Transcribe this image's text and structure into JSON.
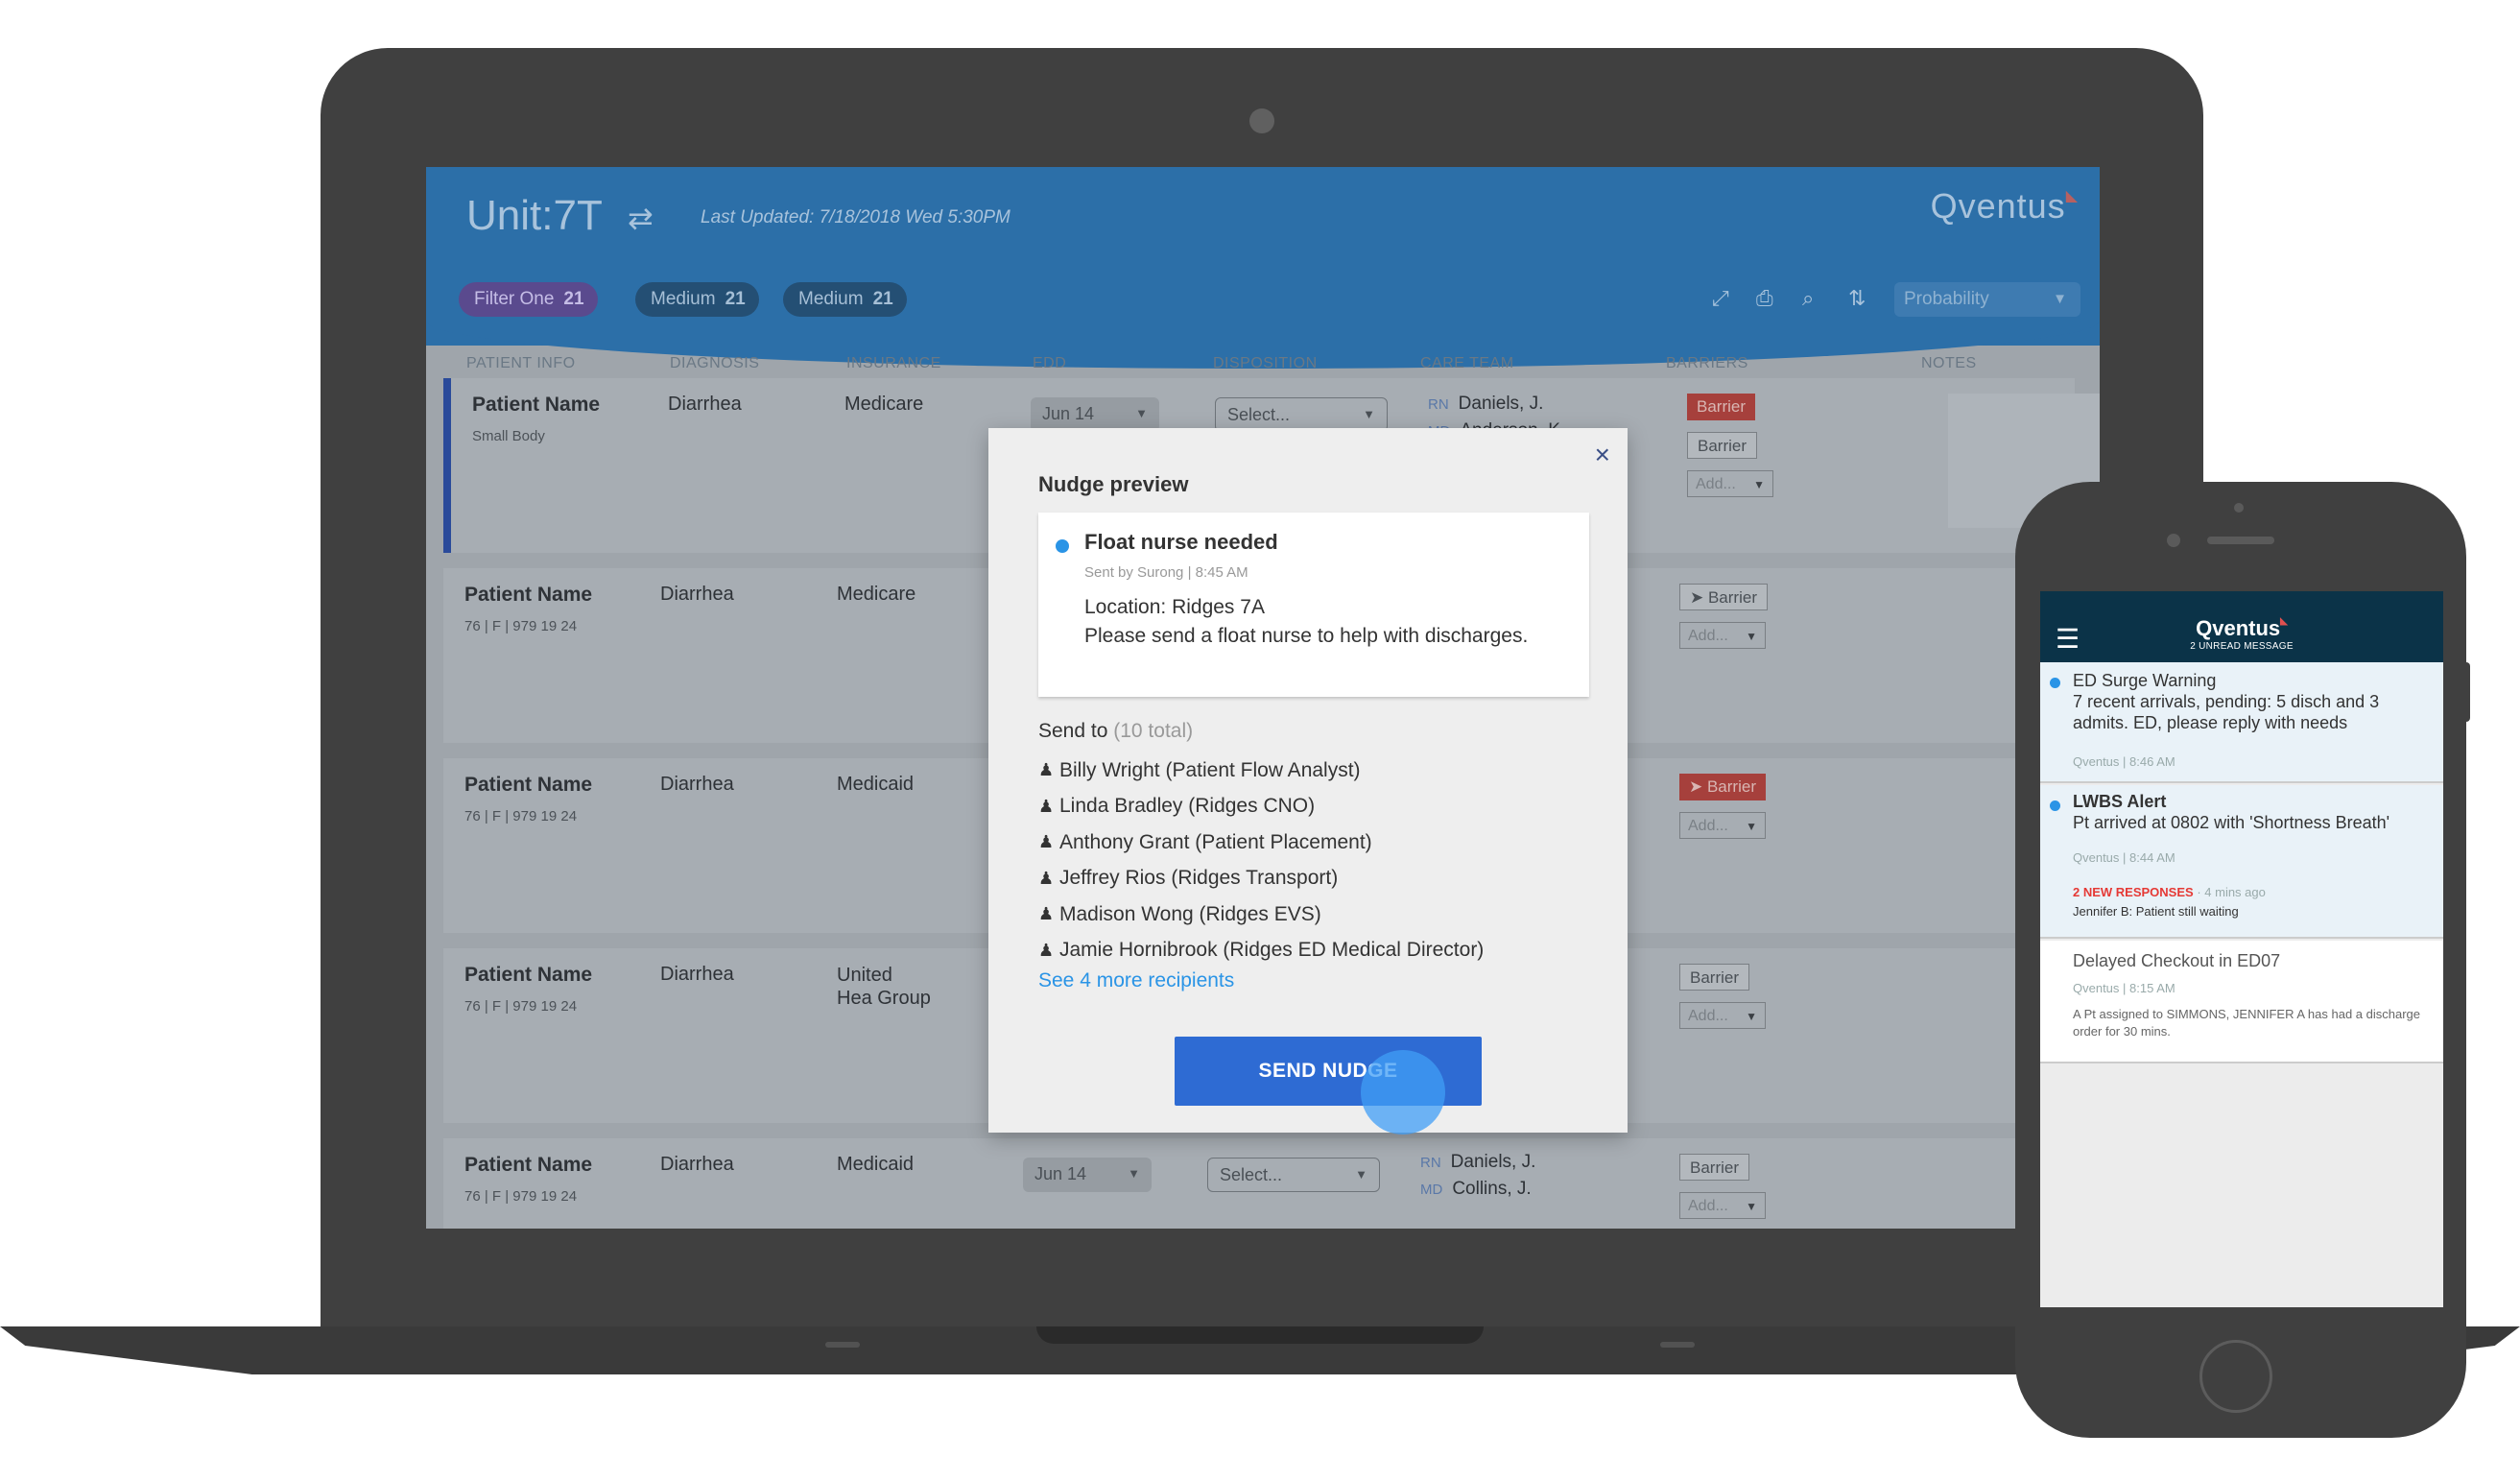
{
  "dashboard": {
    "unit_title": "Unit:7T",
    "switch_icon": "⇄",
    "last_updated": "Last Updated: 7/18/2018 Wed 5:30PM",
    "brand": "Qventus",
    "filters": [
      {
        "label": "Filter One",
        "count": "21"
      },
      {
        "label": "Medium",
        "count": "21"
      },
      {
        "label": "Medium",
        "count": "21"
      }
    ],
    "toolbar_icons": [
      "expand-icon",
      "print-icon",
      "search-icon",
      "sort-icon"
    ],
    "sort_select": "Probability",
    "columns": [
      "PATIENT INFO",
      "DIAGNOSIS",
      "INSURANCE",
      "EDD",
      "DISPOSITION",
      "CARE TEAM",
      "BARRIERS",
      "NOTES"
    ],
    "rows": [
      {
        "name": "Patient Name",
        "sub": "Small Body",
        "diagnosis": "Diarrhea",
        "insurance": "Medicare",
        "edd": "Jun 14",
        "disposition": "Select...",
        "rn": "Daniels, J.",
        "md": "Anderson, K.",
        "barriers": [
          "Barrier",
          "Barrier"
        ],
        "add": "Add..."
      },
      {
        "name": "Patient Name",
        "sub": "76 | F | 979 19 24",
        "diagnosis": "Diarrhea",
        "insurance": "Medicare",
        "barriers": [
          "Barrier"
        ],
        "add": "Add..."
      },
      {
        "name": "Patient Name",
        "sub": "76 | F | 979 19 24",
        "diagnosis": "Diarrhea",
        "insurance": "Medicaid",
        "barriers": [
          "Barrier"
        ],
        "add": "Add..."
      },
      {
        "name": "Patient Name",
        "sub": "76 | F | 979 19 24",
        "diagnosis": "Diarrhea",
        "insurance": "United Hea Group",
        "barriers": [
          "Barrier"
        ],
        "add": "Add..."
      },
      {
        "name": "Patient Name",
        "sub": "76 | F | 979 19 24",
        "diagnosis": "Diarrhea",
        "insurance": "Medicaid",
        "edd": "Jun 14",
        "disposition": "Select...",
        "rn": "Daniels, J.",
        "md": "Collins, J.",
        "barriers": [
          "Barrier"
        ],
        "add": "Add..."
      }
    ],
    "role_rn": "RN",
    "role_md": "MD"
  },
  "modal": {
    "title": "Nudge preview",
    "close": "×",
    "preview": {
      "title": "Float nurse needed",
      "meta": "Sent by Surong | 8:45 AM",
      "location": "Location: Ridges 7A",
      "body": "Please send a float nurse to help with discharges."
    },
    "send_to_label": "Send to",
    "send_to_total": "(10 total)",
    "recipients": [
      "Billy Wright (Patient Flow Analyst)",
      "Linda Bradley (Ridges CNO)",
      "Anthony Grant (Patient Placement)",
      "Jeffrey Rios (Ridges Transport)",
      "Madison Wong (Ridges EVS)",
      "Jamie Hornibrook (Ridges ED Medical Director)"
    ],
    "more_link": "See 4 more recipients",
    "send_button": "SEND NUDGE"
  },
  "phone": {
    "brand": "Qventus",
    "unread": "2 UNREAD MESSAGE",
    "messages": [
      {
        "title": "ED Surge Warning",
        "body": "7 recent arrivals, pending: 5 disch and 3 admits. ED, please reply with needs",
        "meta": "Qventus  |  8:46 AM",
        "unread": true
      },
      {
        "title": "LWBS Alert",
        "body": "Pt arrived at 0802 with 'Shortness Breath'",
        "meta": "Qventus | 8:44 AM",
        "new_responses": "2 NEW RESPONSES",
        "ago": "· 4 mins ago",
        "reply": "Jennifer B: Patient still waiting",
        "unread": true
      },
      {
        "title": "Delayed Checkout in ED07",
        "meta": "Qventus | 8:15 AM",
        "detail": "A Pt assigned to SIMMONS, JENNIFER A has had a discharge order for 30 mins.",
        "unread": false
      }
    ]
  }
}
